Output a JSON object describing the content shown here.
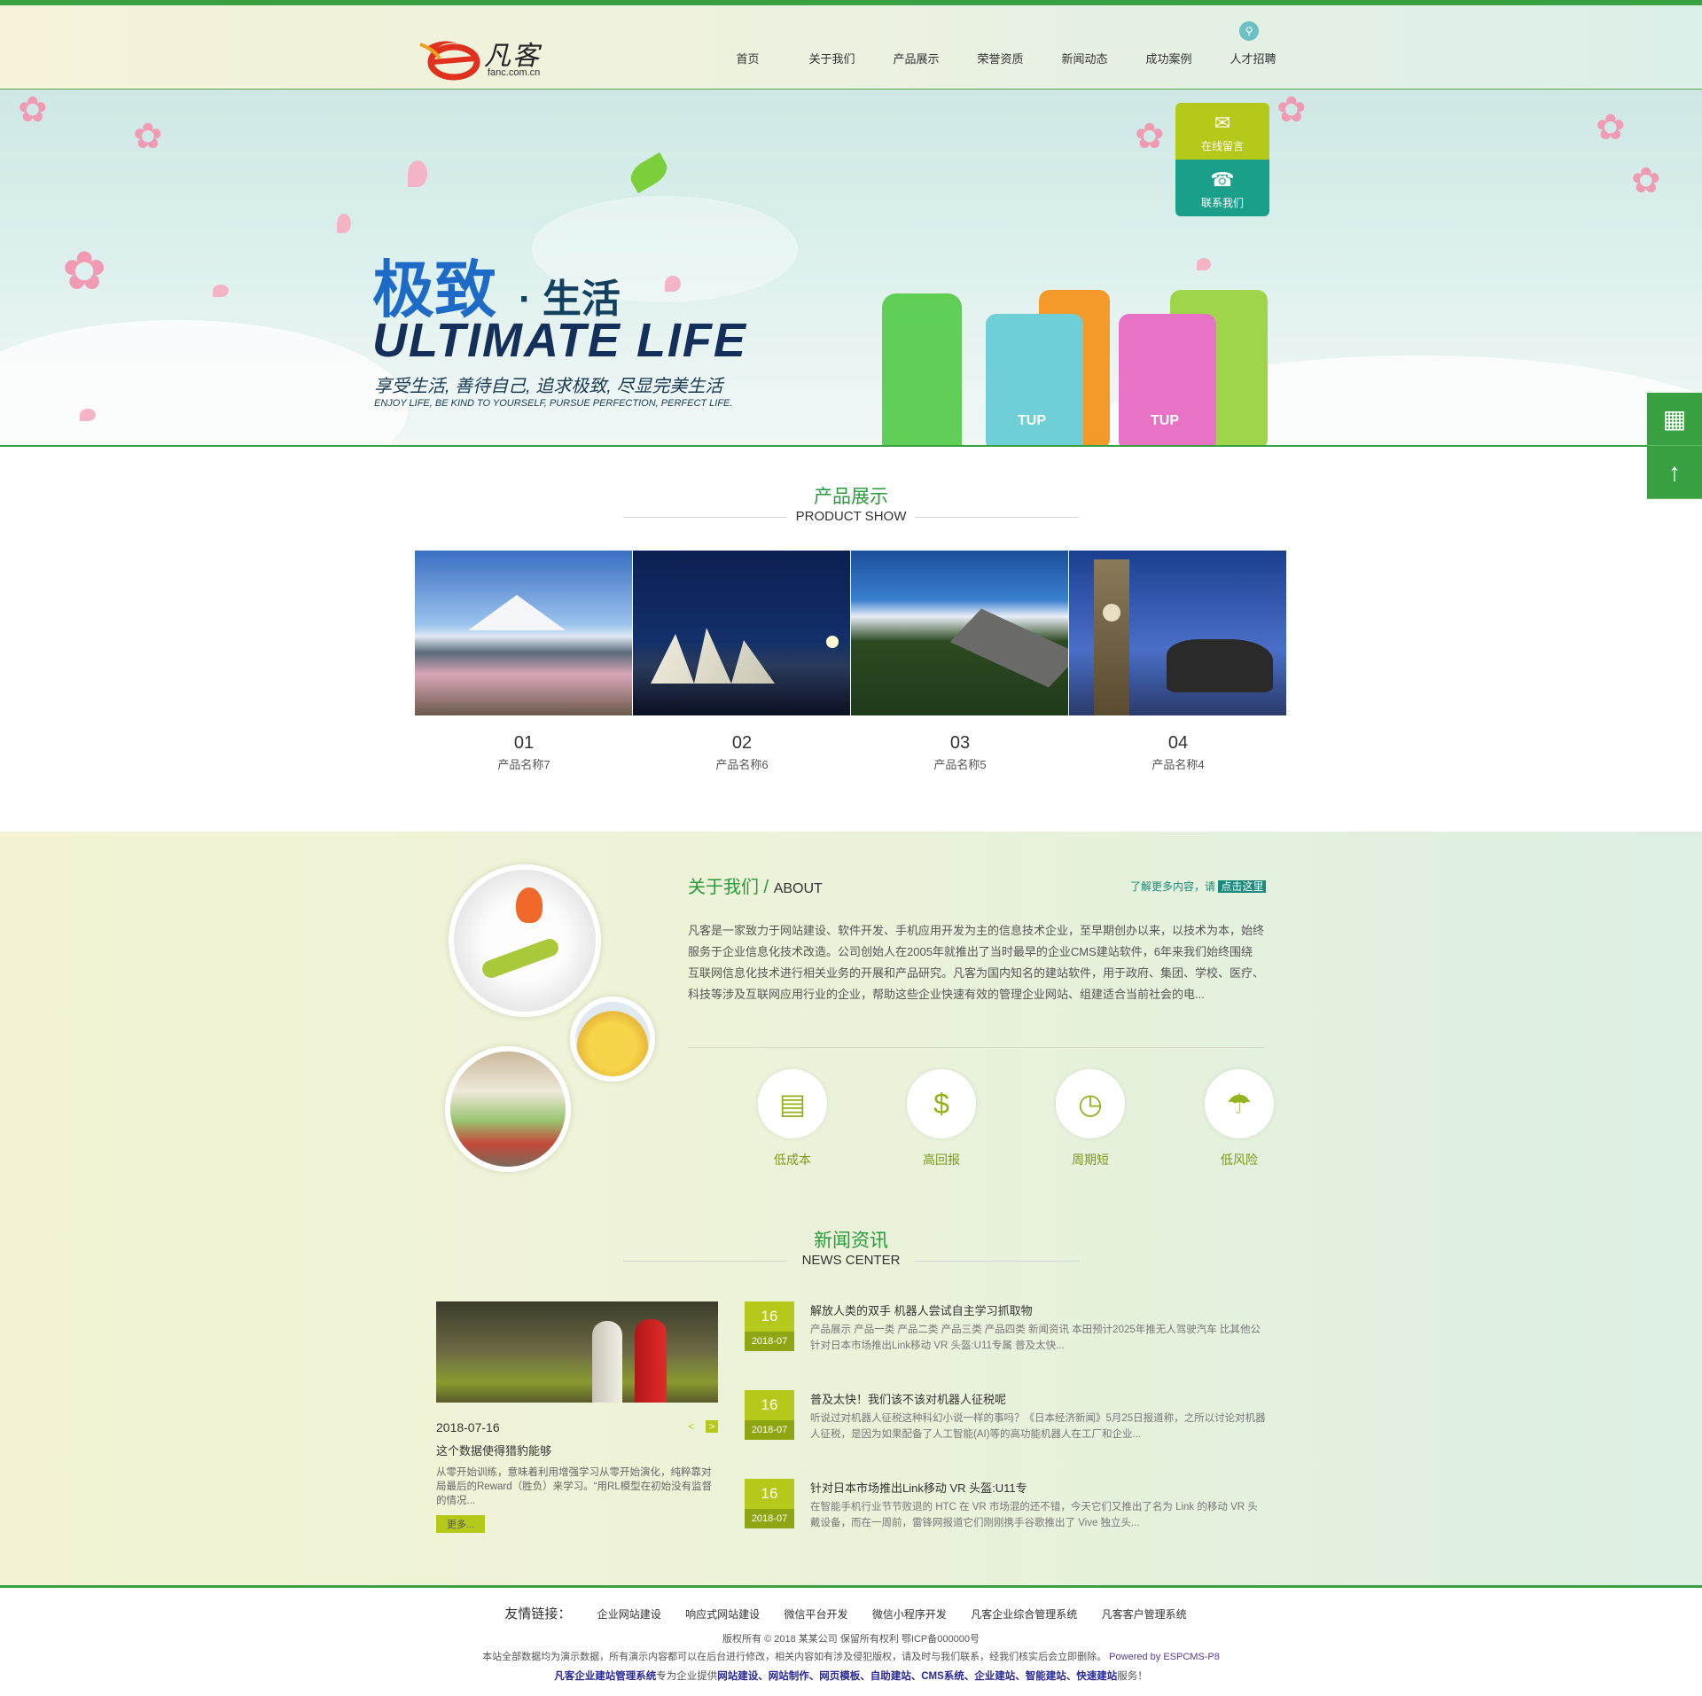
{
  "header": {
    "logo_cn": "凡客",
    "logo_url": "fanc.com.cn",
    "nav": [
      "首页",
      "关于我们",
      "产品展示",
      "荣誉资质",
      "新闻动态",
      "成功案例",
      "人才招聘"
    ],
    "search_icon": "search-icon"
  },
  "banner": {
    "title_cn_1": "极致",
    "title_cn_2": "· 生活",
    "title_en": "ULTIMATE  LIFE",
    "sub_cn": "享受生活, 善待自己, 追求极致, 尽显完美生活",
    "sub_en": "ENJOY LIFE, BE KIND TO YOURSELF, PURSUE PERFECTION, PERFECT LIFE.",
    "cup_label": "TUP",
    "float_msg": "在线留言",
    "float_contact": "联系我们"
  },
  "products": {
    "heading_cn": "产品展示",
    "heading_en": "PRODUCT SHOW",
    "items": [
      {
        "num": "01",
        "name": "产品名称7"
      },
      {
        "num": "02",
        "name": "产品名称6"
      },
      {
        "num": "03",
        "name": "产品名称5"
      },
      {
        "num": "04",
        "name": "产品名称4"
      }
    ]
  },
  "about": {
    "title_cn": "关于我们 /",
    "title_en": "ABOUT",
    "more_text": "了解更多内容，请",
    "more_link": "点击这里",
    "text": "凡客是一家致力于网站建设、软件开发、手机应用开发为主的信息技术企业，至早期创办以来，以技术为本，始终服务于企业信息化技术改造。公司创始人在2005年就推出了当时最早的企业CMS建站软件，6年来我们始终围绕互联网信息化技术进行相关业务的开展和产品研究。凡客为国内知名的建站软件，用于政府、集团、学校、医疗、科技等涉及互联网应用行业的企业，帮助这些企业快速有效的管理企业网站、组建适合当前社会的电...",
    "features": [
      "低成本",
      "高回报",
      "周期短",
      "低风险"
    ]
  },
  "news": {
    "heading_cn": "新闻资讯",
    "heading_en": "NEWS CENTER",
    "featured": {
      "date": "2018-07-16",
      "title": "这个数据使得猎豹能够",
      "desc": "从零开始训练，意味着利用增强学习从零开始演化，纯粹靠对局最后的Reward（胜负）来学习。“用RL模型在初始没有监督的情况...",
      "more": "更多..."
    },
    "items": [
      {
        "day": "16",
        "month": "2018-07",
        "title": "解放人类的双手 机器人尝试自主学习抓取物",
        "summary": "产品展示 产品一类 产品二类 产品三类 产品四类 新闻资讯 本田预计2025年推无人驾驶汽车 比其他公 针对日本市场推出Link移动 VR 头盔:U11专属 普及太快..."
      },
      {
        "day": "16",
        "month": "2018-07",
        "title": "普及太快！我们该不该对机器人征税呢",
        "summary": "听说过对机器人征税这种科幻小说一样的事吗？《日本经济新闻》5月25日报道称，之所以讨论对机器人征税，是因为如果配备了人工智能(AI)等的高功能机器人在工厂和企业..."
      },
      {
        "day": "16",
        "month": "2018-07",
        "title": "针对日本市场推出Link移动 VR 头盔:U11专",
        "summary": "在智能手机行业节节败退的 HTC 在 VR 市场混的还不错，今天它们又推出了名为 Link 的移动 VR 头戴设备，而在一周前，雷锋网报道它们刚刚携手谷歌推出了 Vive 独立头..."
      }
    ]
  },
  "footer": {
    "links_title": "友情链接：",
    "links": [
      "企业网站建设",
      "响应式网站建设",
      "微信平台开发",
      "微信小程序开发",
      "凡客企业综合管理系统",
      "凡客客户管理系统"
    ],
    "copyright": "版权所有 © 2018 某某公司 保留所有权利 鄂ICP备000000号",
    "note": "本站全部数据均为演示数据，所有演示内容都可以在后台进行修改，相关内容如有涉及侵犯版权，请及时与我们联系，经我们核实后会立即删除。",
    "powered": "Powered by ESPCMS-P8",
    "kw_1": "凡客企业建站管理系统",
    "kw_2": "专为企业提供",
    "kw_3": "网站建设、网站制作、网页模板、自助建站、CMS系统、企业建站、智能建站、快速建站",
    "kw_4": "服务！"
  },
  "colors": {
    "brand_green": "#3aa142",
    "accent_olive": "#b5c91a",
    "teal": "#1aa08a"
  }
}
